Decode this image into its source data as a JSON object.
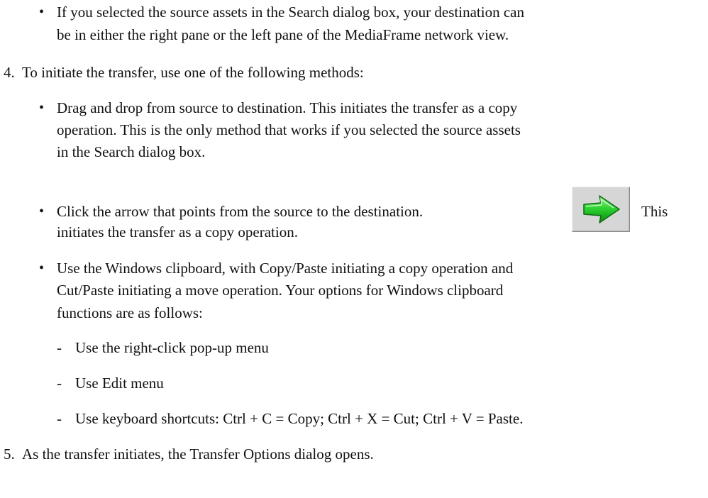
{
  "steps": [
    {
      "number": "",
      "bullets": [
        {
          "lines": [
            "If you selected the source assets in the Search dialog box, your destination can",
            "be in either the right pane or the left pane of the MediaFrame network view."
          ]
        }
      ]
    },
    {
      "number": "4.",
      "text": "To initiate the transfer, use one of the following methods:",
      "bullets": [
        {
          "lines": [
            "Drag and drop from source to destination. This initiates the transfer as a copy",
            "operation. This is the only method that works if you selected the source assets",
            "in the Search dialog box."
          ]
        },
        {
          "lines": [
            "Click the arrow that points from the source to the destination.",
            "initiates the transfer as a copy operation."
          ],
          "trailing_word": "This",
          "icon": "green-right-arrow-icon",
          "icon_color": "#22c02a"
        },
        {
          "lines": [
            "Use the Windows clipboard, with Copy/Paste initiating a copy operation and",
            "Cut/Paste initiating a move operation. Your options for Windows clipboard",
            "functions are as follows:"
          ],
          "sub_items": [
            "Use the right-click pop-up menu",
            "Use Edit menu",
            "Use keyboard shortcuts: Ctrl + C = Copy; Ctrl + X = Cut; Ctrl + V = Paste."
          ]
        }
      ]
    },
    {
      "number": "5.",
      "text": "As the transfer initiates, the Transfer Options dialog opens."
    }
  ]
}
